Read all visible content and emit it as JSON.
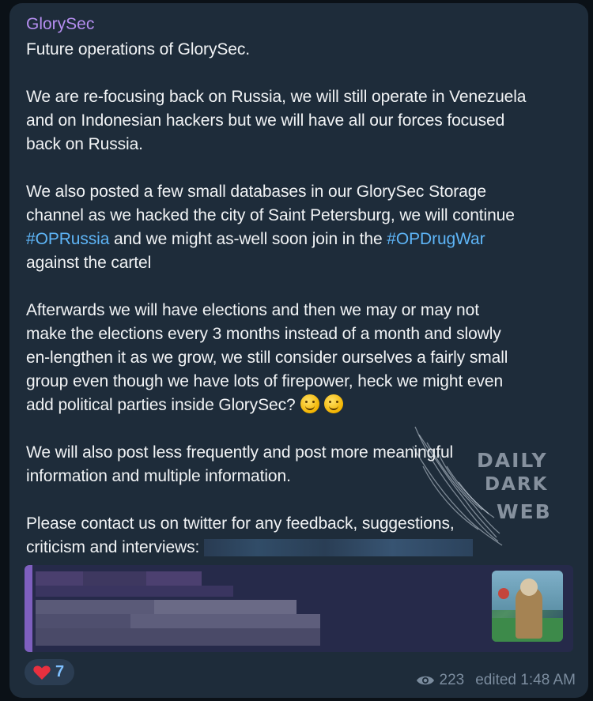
{
  "message": {
    "sender": "GlorySec",
    "lines": [
      {
        "text": "Future operations of GlorySec."
      },
      {
        "gap": true
      },
      {
        "text": "We are re-focusing back on Russia, we will still operate in Venezuela"
      },
      {
        "text": "and on Indonesian hackers but we will have all our forces focused"
      },
      {
        "text": "back on Russia."
      },
      {
        "gap": true
      },
      {
        "text": "We also posted a few small databases in our GlorySec Storage"
      },
      {
        "text": "channel as we hacked the city of Saint Petersburg, we will continue"
      },
      {
        "text_parts": [
          {
            "t": "#OPRussia",
            "tag": true
          },
          {
            "t": " and we might as-well soon join in the "
          },
          {
            "t": "#OPDrugWar",
            "tag": true
          }
        ]
      },
      {
        "text": "against the cartel"
      },
      {
        "gap": true
      },
      {
        "text": "Afterwards we will have elections and then we may or may not"
      },
      {
        "text": "make the elections every 3 months instead of a month and slowly"
      },
      {
        "text": "en-lengthen it as we grow, we still consider ourselves a fairly small"
      },
      {
        "text": "group even though we have lots of firepower, heck we might even"
      },
      {
        "text": "add political parties inside GlorySec?",
        "emojis": [
          "rofl-emoji",
          "wink-emoji"
        ]
      },
      {
        "gap": true
      },
      {
        "text": "We will also post less frequently and post more meaningful"
      },
      {
        "text": "information and multiple information."
      },
      {
        "gap": true
      },
      {
        "text": "Please contact us on twitter for any feedback, suggestions,"
      },
      {
        "text": "criticism and interviews:",
        "redacted_link": true
      }
    ]
  },
  "watermark": {
    "line1": "DAILY",
    "line2": "DARK",
    "line3": "WEB"
  },
  "reaction": {
    "icon": "heart-icon",
    "count": "7"
  },
  "meta": {
    "views_icon": "eye-icon",
    "views": "223",
    "status": "edited 1:48 AM"
  },
  "colors": {
    "sender": "#b58ef0",
    "hashtag": "#5eb5f7",
    "bubble": "#1e2c3a",
    "preview_accent": "#7e5fbf"
  }
}
